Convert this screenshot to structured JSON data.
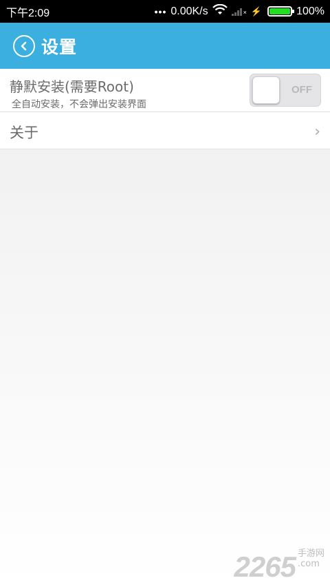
{
  "status_bar": {
    "time": "下午2:09",
    "dots": "•••",
    "net_speed": "0.00K/s",
    "battery": "100%",
    "icons": [
      "wifi-icon",
      "signal-icon",
      "charging-icon",
      "battery-icon"
    ]
  },
  "header": {
    "title": "设置",
    "back_icon": "back-arrow-circle-icon",
    "background": "#3aafe0"
  },
  "settings": {
    "silent_install": {
      "title": "静默安装(需要Root)",
      "subtitle": "全自动安装，不会弹出安装界面",
      "toggle_label": "OFF",
      "enabled": false
    },
    "about": {
      "label": "关于",
      "chevron_icon": "chevron-right-icon"
    }
  },
  "watermark": {
    "number": "2265",
    "suffix": ".com",
    "site_name": "手游网"
  }
}
